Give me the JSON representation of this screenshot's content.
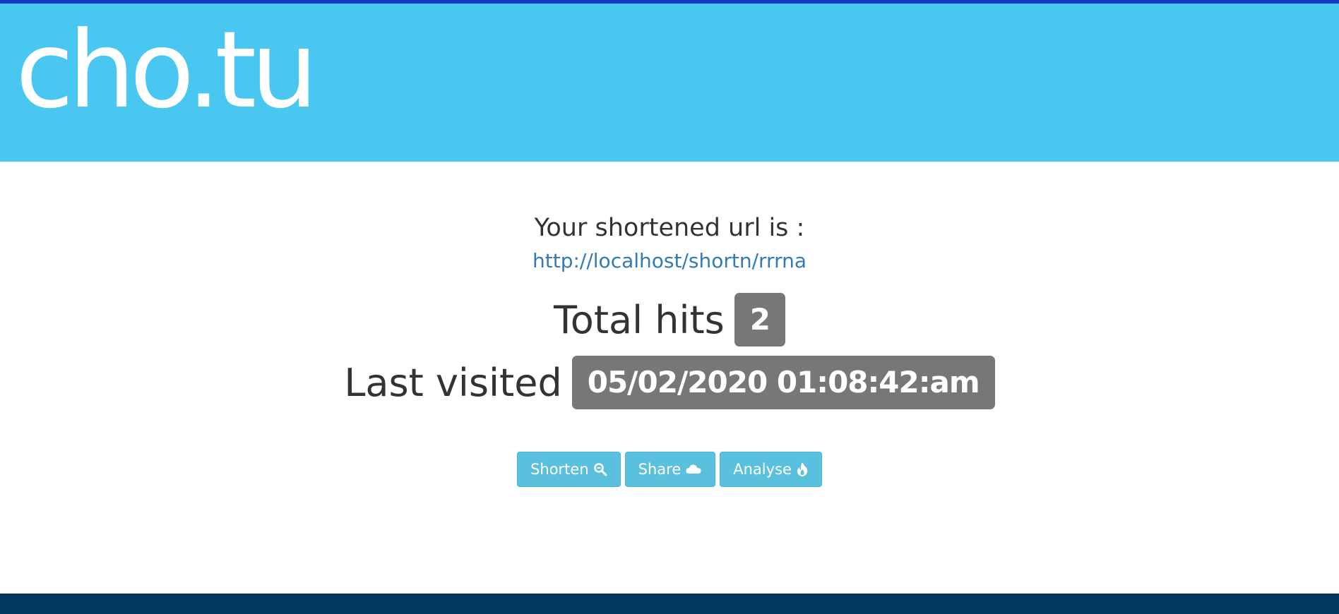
{
  "header": {
    "logo": "cho.tu"
  },
  "result": {
    "intro_text": "Your shortened url is :",
    "short_url": "http://localhost/shortn/rrrna",
    "total_hits_label": "Total hits",
    "total_hits_value": "2",
    "last_visited_label": "Last visited",
    "last_visited_value": "05/02/2020 01:08:42:am"
  },
  "buttons": {
    "shorten_label": "Shorten",
    "share_label": "Share",
    "analyse_label": "Analyse"
  },
  "icons": {
    "shorten": "search-icon",
    "share": "cloud-icon",
    "analyse": "fire-icon"
  },
  "colors": {
    "header_bg": "#49c7f0",
    "button_bg": "#5bc0de",
    "badge_bg": "#777777",
    "link": "#337ab7",
    "footer_bg": "#023760",
    "top_edge": "#1a36c9"
  }
}
